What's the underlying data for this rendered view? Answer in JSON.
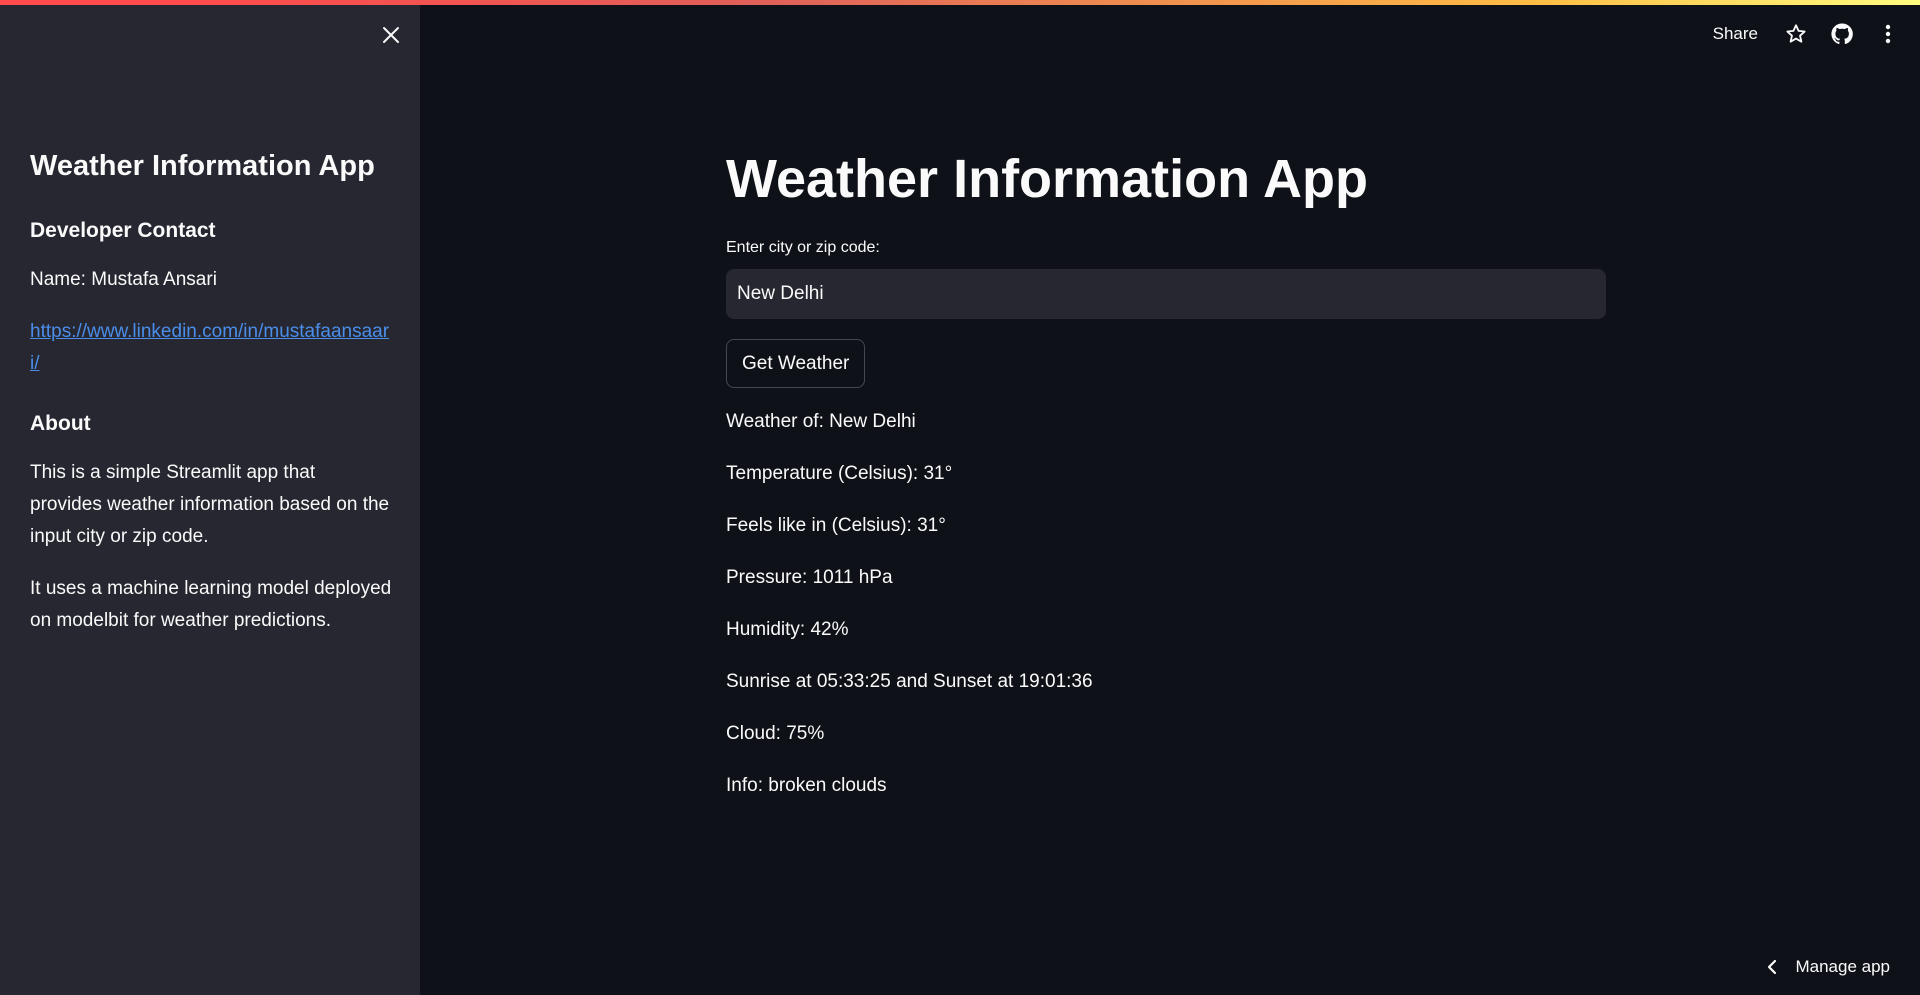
{
  "sidebar": {
    "title": "Weather Information App",
    "contact_heading": "Developer Contact",
    "name_line": "Name: Mustafa Ansari",
    "linkedin_url": "https://www.linkedin.com/in/mustafaansaari/",
    "about_heading": "About",
    "about_p1": "This is a simple Streamlit app that provides weather information based on the input city or zip code.",
    "about_p2": "It uses a machine learning model deployed on modelbit for weather predictions."
  },
  "header": {
    "share_label": "Share",
    "icons": [
      "star-icon",
      "github-icon",
      "more-vertical-icon"
    ]
  },
  "main": {
    "title": "Weather Information App",
    "input_label": "Enter city or zip code:",
    "input_value": "New Delhi",
    "button_label": "Get Weather",
    "results": [
      "Weather of: New Delhi",
      "Temperature (Celsius): 31°",
      "Feels like in (Celsius): 31°",
      "Pressure: 1011 hPa",
      "Humidity: 42%",
      "Sunrise at 05:33:25 and Sunset at 19:01:36",
      "Cloud: 75%",
      "Info: broken clouds"
    ]
  },
  "footer": {
    "manage_label": "Manage app"
  },
  "colors": {
    "background": "#0e1117",
    "sidebar": "#262730",
    "link": "#4a8eea"
  }
}
